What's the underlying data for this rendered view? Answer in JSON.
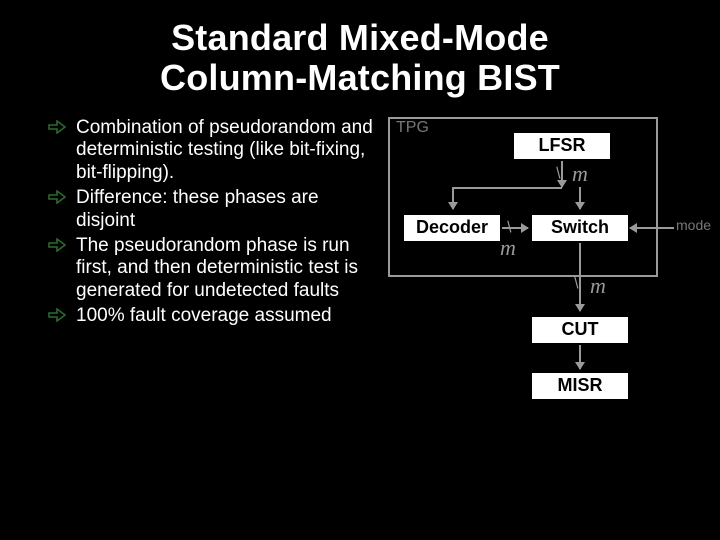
{
  "title": {
    "line1": "Standard Mixed-Mode",
    "line2": "Column-Matching BIST"
  },
  "bullets": [
    "Combination of pseudorandom and deterministic testing (like bit-fixing, bit-flipping).",
    "Difference: these phases are disjoint",
    "The pseudorandom phase is run first, and then deterministic test is generated for undetected faults",
    "100% fault coverage assumed"
  ],
  "diagram": {
    "tpg_label": "TPG",
    "boxes": {
      "lfsr": "LFSR",
      "decoder": "Decoder",
      "switch": "Switch",
      "cut": "CUT",
      "misr": "MISR"
    },
    "mode_label": "mode",
    "bus_label": "m"
  }
}
